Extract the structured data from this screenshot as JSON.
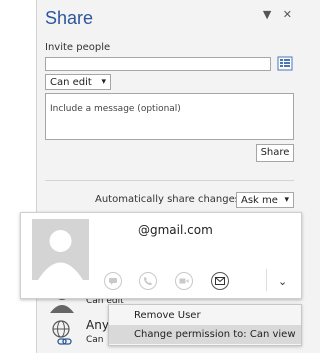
{
  "pane": {
    "title": "Share",
    "invite_label": "Invite people",
    "invite_value": "",
    "permission_select": "Can edit",
    "message_placeholder": "Include a message (optional)",
    "share_button": "Share",
    "auto_share_label": "Automatically share changes:",
    "auto_share_value": "Ask me"
  },
  "user_card": {
    "email": "@gmail.com"
  },
  "list": {
    "user_perm": "Can edit",
    "anyone_label": "Any",
    "anyone_perm": "Can"
  },
  "context_menu": {
    "items": [
      {
        "label": "Remove User",
        "accel": "R"
      },
      {
        "label": "Change permission to: Can view",
        "accel": "v"
      }
    ]
  },
  "colors": {
    "accent": "#2b579a",
    "menu_highlight": "#d9d9d9"
  }
}
